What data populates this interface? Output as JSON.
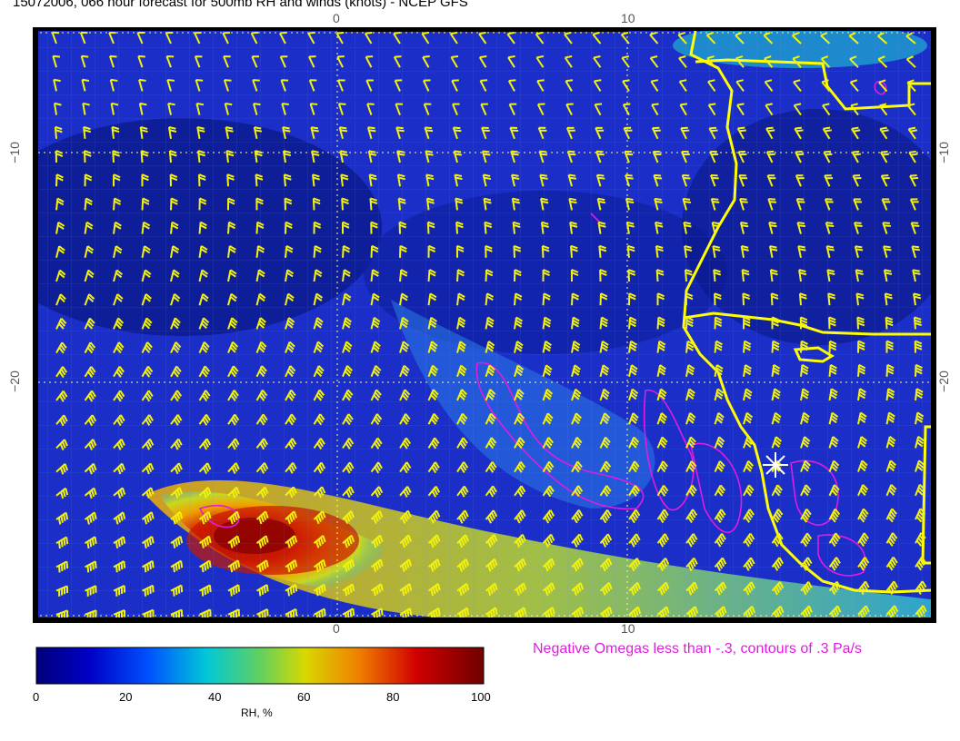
{
  "title": "15072006, 066 hour forecast for 500mb RH and winds (knots) - NCEP GFS",
  "axes": {
    "top_ticks": [
      "0",
      "10"
    ],
    "bottom_ticks": [
      "0",
      "10"
    ],
    "left_ticks": [
      "−10",
      "−20"
    ],
    "right_ticks": [
      "−10",
      "−20"
    ]
  },
  "legend": {
    "colorbar_ticks": [
      "0",
      "20",
      "40",
      "60",
      "80",
      "100"
    ],
    "colorbar_title": "RH, %",
    "omega_note": "Negative Omegas less than -.3, contours of .3 Pa/s"
  },
  "colors": {
    "background_rh": "#1b2fc8",
    "dry_rh": "#0b1a8c",
    "wind_barbs": "#f2f20a",
    "coastline": "#ffff00",
    "omega_contours": "#e21be0",
    "grid_lines": "#ffff80",
    "station_marker": "#ffffff"
  },
  "icons": {
    "station_marker": "star-marker-icon",
    "wind_barb": "wind-barb-icon"
  }
}
